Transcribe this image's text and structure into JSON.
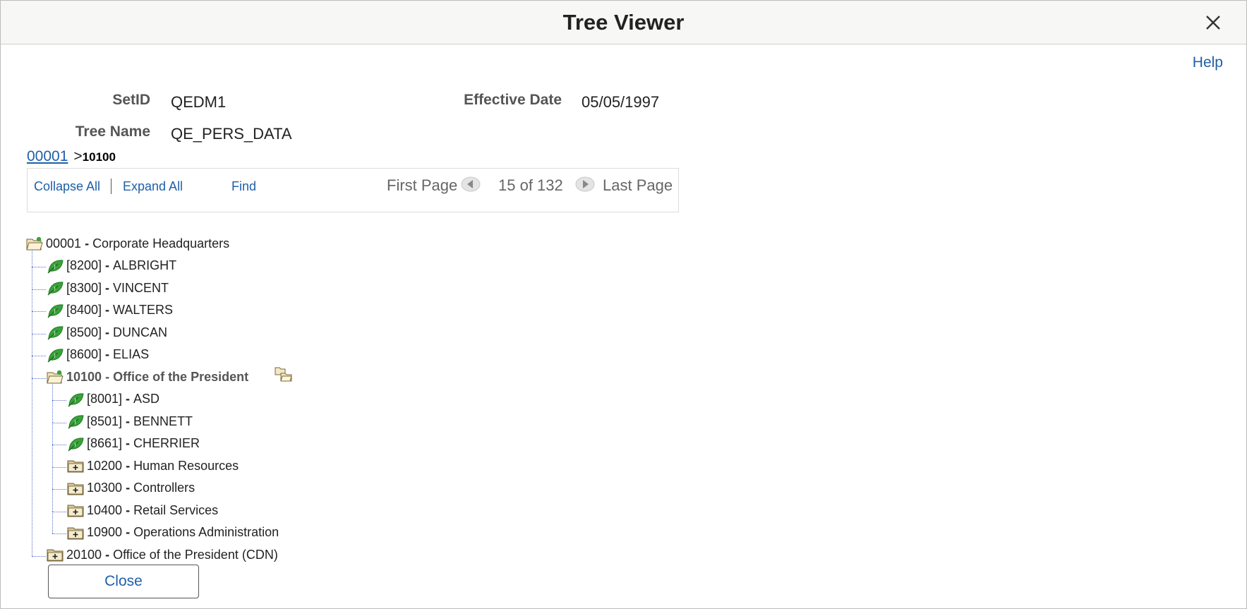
{
  "window": {
    "title": "Tree Viewer",
    "help_label": "Help"
  },
  "fields": {
    "setid_label": "SetID",
    "setid_value": "QEDM1",
    "effdate_label": "Effective Date",
    "effdate_value": "05/05/1997",
    "treename_label": "Tree Name",
    "treename_value": "QE_PERS_DATA"
  },
  "breadcrumb": {
    "root": "00001",
    "separator": ">",
    "current": "10100"
  },
  "toolbar": {
    "collapse_all": "Collapse All",
    "expand_all": "Expand All",
    "find": "Find",
    "first_page": "First Page",
    "page_status": "15 of 132",
    "last_page": "Last Page"
  },
  "tree": [
    {
      "level": 0,
      "icon": "open-folder-icon",
      "key": "00001",
      "label": "Corporate Headquarters"
    },
    {
      "level": 1,
      "icon": "leaf-icon",
      "key": "[8200]",
      "label": "ALBRIGHT"
    },
    {
      "level": 1,
      "icon": "leaf-icon",
      "key": "[8300]",
      "label": "VINCENT"
    },
    {
      "level": 1,
      "icon": "leaf-icon",
      "key": "[8400]",
      "label": "WALTERS"
    },
    {
      "level": 1,
      "icon": "leaf-icon",
      "key": "[8500]",
      "label": "DUNCAN"
    },
    {
      "level": 1,
      "icon": "leaf-icon",
      "key": "[8600]",
      "label": "ELIAS"
    },
    {
      "level": 1,
      "icon": "open-folder-icon",
      "key": "10100",
      "label": "Office of the President",
      "selected": true
    },
    {
      "level": 2,
      "icon": "leaf-icon",
      "key": "[8001]",
      "label": "ASD"
    },
    {
      "level": 2,
      "icon": "leaf-icon",
      "key": "[8501]",
      "label": "BENNETT"
    },
    {
      "level": 2,
      "icon": "leaf-icon",
      "key": "[8661]",
      "label": "CHERRIER"
    },
    {
      "level": 2,
      "icon": "closed-folder-icon",
      "key": "10200",
      "label": "Human Resources"
    },
    {
      "level": 2,
      "icon": "closed-folder-icon",
      "key": "10300",
      "label": "Controllers"
    },
    {
      "level": 2,
      "icon": "closed-folder-icon",
      "key": "10400",
      "label": "Retail Services"
    },
    {
      "level": 2,
      "icon": "closed-folder-icon",
      "key": "10900",
      "label": "Operations Administration"
    },
    {
      "level": 1,
      "icon": "closed-folder-icon",
      "key": "20100",
      "label": "Office of the President (CDN)"
    }
  ],
  "footer": {
    "close_label": "Close"
  },
  "colors": {
    "link": "#1f5fa8",
    "leaf": "#3aa23a",
    "folder": "#d9c79a",
    "connector": "#5a6fc8"
  }
}
